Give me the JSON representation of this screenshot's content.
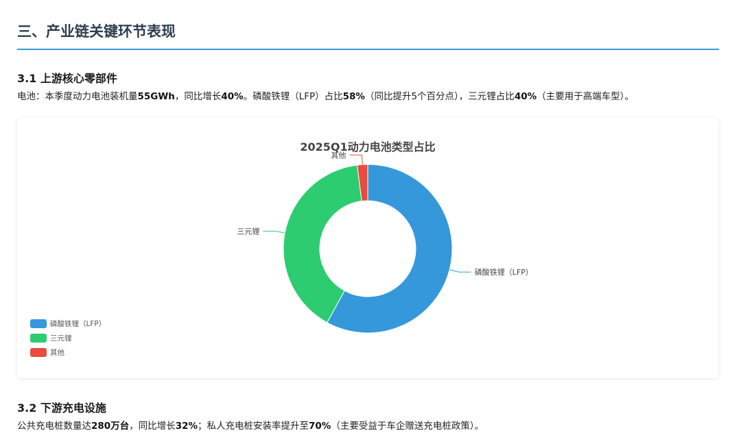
{
  "section": {
    "title": "三、产业链关键环节表现"
  },
  "upstream": {
    "title": "3.1 上游核心零部件",
    "parts": [
      {
        "t": "电池：本季度动力电池装机量",
        "b": false
      },
      {
        "t": "55GWh",
        "b": true
      },
      {
        "t": "，同比增长",
        "b": false
      },
      {
        "t": "40%",
        "b": true
      },
      {
        "t": "。磷酸铁锂（LFP）占比",
        "b": false
      },
      {
        "t": "58%",
        "b": true
      },
      {
        "t": "（同比提升5个百分点），三元锂占比",
        "b": false
      },
      {
        "t": "40%",
        "b": true
      },
      {
        "t": "（主要用于高端车型）。",
        "b": false
      }
    ]
  },
  "downstream": {
    "title": "3.2 下游充电设施",
    "parts": [
      {
        "t": "公共充电桩数量达",
        "b": false
      },
      {
        "t": "280万台",
        "b": true
      },
      {
        "t": "，同比增长",
        "b": false
      },
      {
        "t": "32%",
        "b": true
      },
      {
        "t": "；私人充电桩安装率提升至",
        "b": false
      },
      {
        "t": "70%",
        "b": true
      },
      {
        "t": "（主要受益于车企赠送充电桩政策）。",
        "b": false
      }
    ]
  },
  "chart_data": {
    "type": "pie",
    "title": "2025Q1动力电池类型占比",
    "categories": [
      "磷酸铁锂（LFP）",
      "三元锂",
      "其他"
    ],
    "values": [
      58,
      40,
      2
    ],
    "colors": [
      "#3498db",
      "#2ecc71",
      "#e74c3c"
    ],
    "donut": true,
    "legend_position": "bottom-left"
  }
}
